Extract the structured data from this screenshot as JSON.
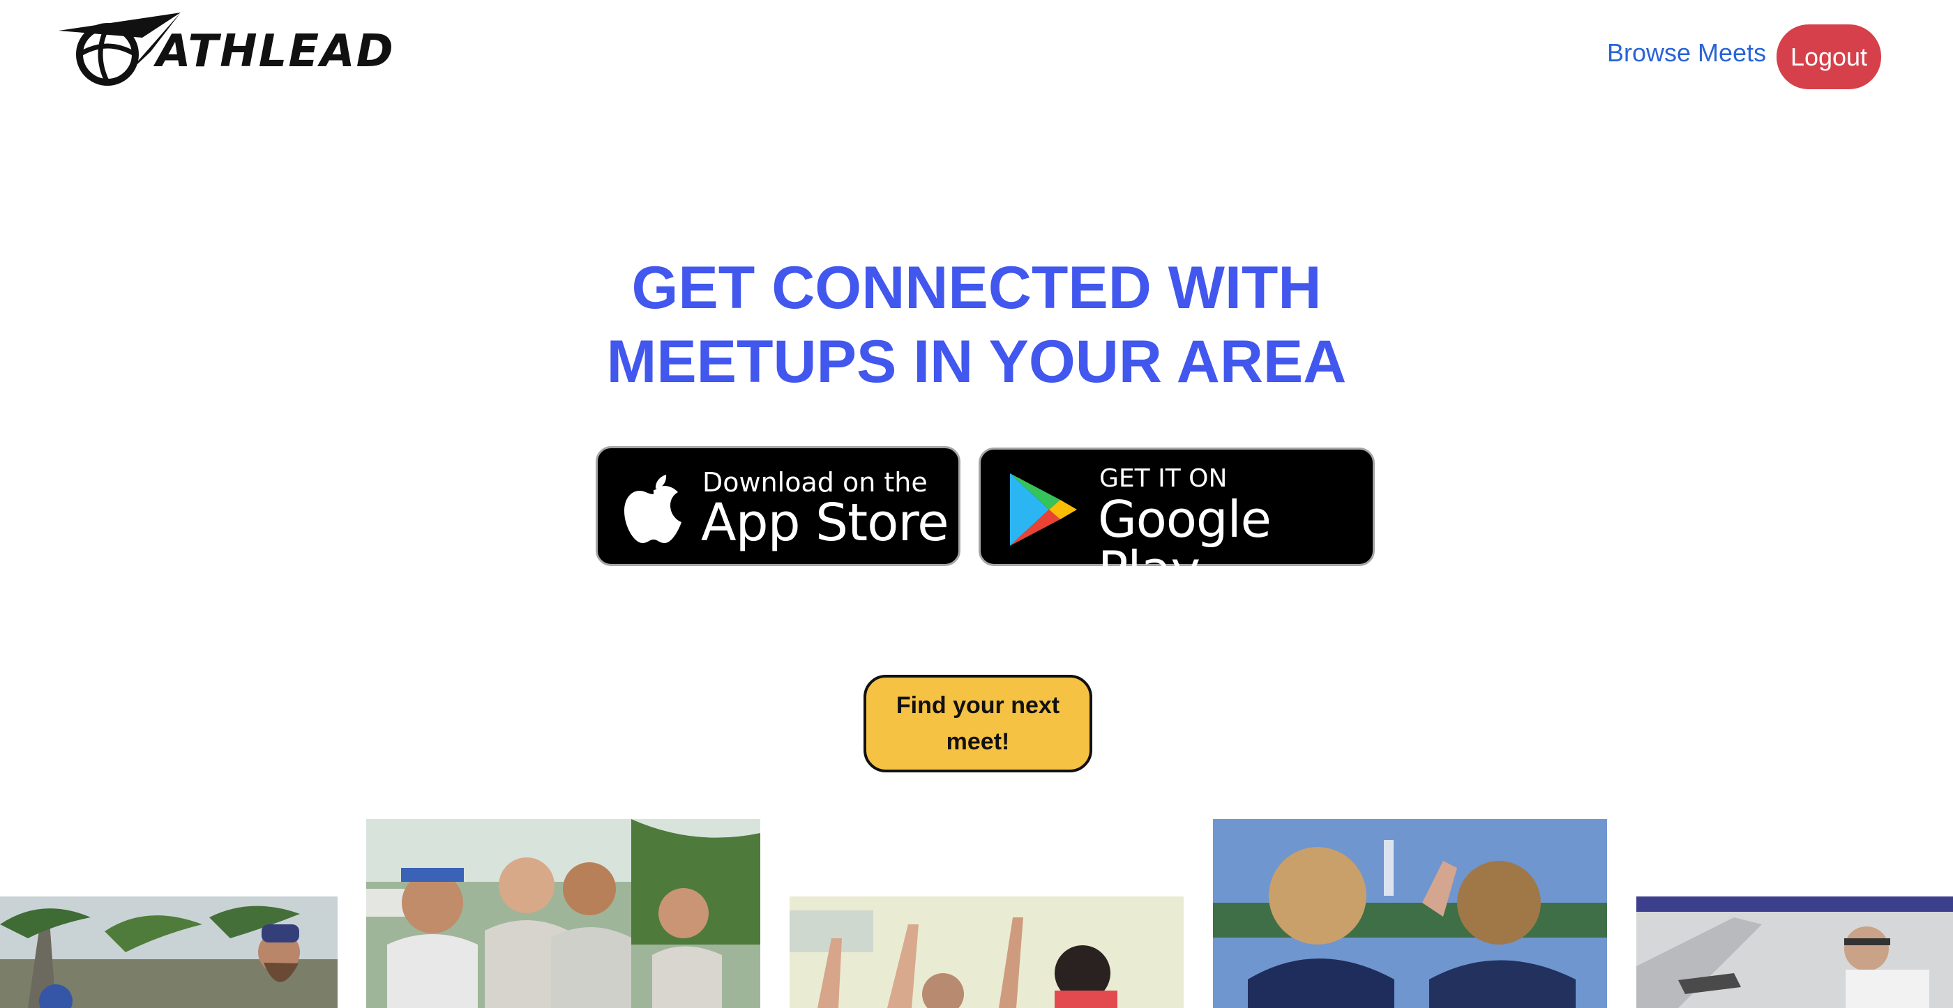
{
  "header": {
    "logo_text": "ATHLEAD",
    "logo_icon": "athlead-ball-icon",
    "nav": {
      "browse_label": "Browse Meets",
      "logout_label": "Logout"
    }
  },
  "hero": {
    "headline_line1": "GET CONNECTED WITH",
    "headline_line2": "MEETUPS IN YOUR AREA"
  },
  "badges": {
    "app_store": {
      "small": "Download on the",
      "big": "App Store",
      "icon": "apple-icon"
    },
    "google_play": {
      "small": "GET IT ON",
      "big": "Google Play",
      "icon": "play-triangle-icon"
    }
  },
  "cta": {
    "label": "Find your next meet!"
  },
  "gallery": {
    "photos": [
      "palm-trees-crowd-photo",
      "team-group-photo",
      "indoor-high-five-photo",
      "jerseys-celebration-photo",
      "player-diving-photo"
    ]
  },
  "colors": {
    "brand_blue": "#4257ee",
    "link_blue": "#2a63d6",
    "logout_red": "#d6404a",
    "cta_yellow": "#f6c244",
    "badge_black": "#000000"
  }
}
